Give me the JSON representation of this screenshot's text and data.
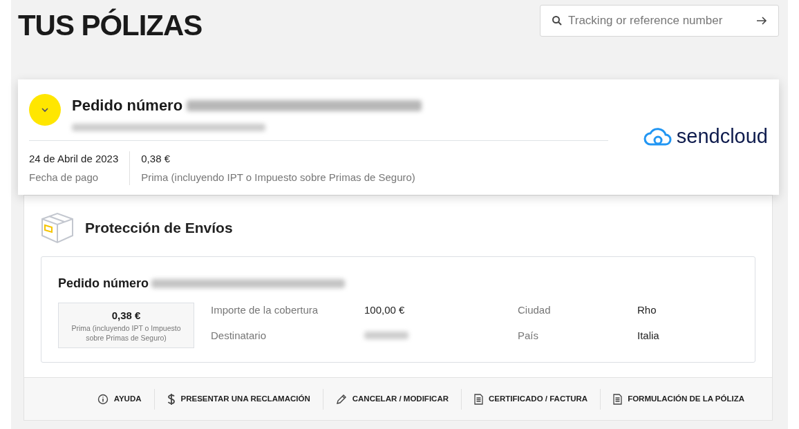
{
  "page_title": "TUS PÓLIZAS",
  "search": {
    "placeholder": "Tracking or reference number"
  },
  "order_card": {
    "expanded": false,
    "title": "Pedido número",
    "logo_text": "sendcloud",
    "date": "24 de Abril de 2023",
    "date_label": "Fecha de pago",
    "premium": "0,38 €",
    "premium_label": "Prima (incluyendo IPT o Impuesto sobre Primas de Seguro)"
  },
  "protection": {
    "title": "Protección de Envíos",
    "order_title": "Pedido número",
    "premium": "0,38 €",
    "premium_label": "Prima (incluyendo IPT o Impuesto sobre Primas de Seguro)",
    "fields": [
      {
        "label": "Importe de la cobertura",
        "value": "100,00 €"
      },
      {
        "label": "Ciudad",
        "value": "Rho"
      },
      {
        "label": "Destinatario",
        "kind": "redacted"
      },
      {
        "label": "País",
        "value": "Italia"
      }
    ]
  },
  "actions": [
    {
      "kind": "info",
      "label": "AYUDA"
    },
    {
      "kind": "dollar",
      "label": "PRESENTAR UNA RECLAMACIÓN"
    },
    {
      "kind": "pencil",
      "label": "CANCELAR / MODIFICAR"
    },
    {
      "kind": "document",
      "label": "CERTIFICADO / FACTURA"
    },
    {
      "kind": "document",
      "label": "FORMULACIÓN DE LA PÓLIZA"
    }
  ]
}
